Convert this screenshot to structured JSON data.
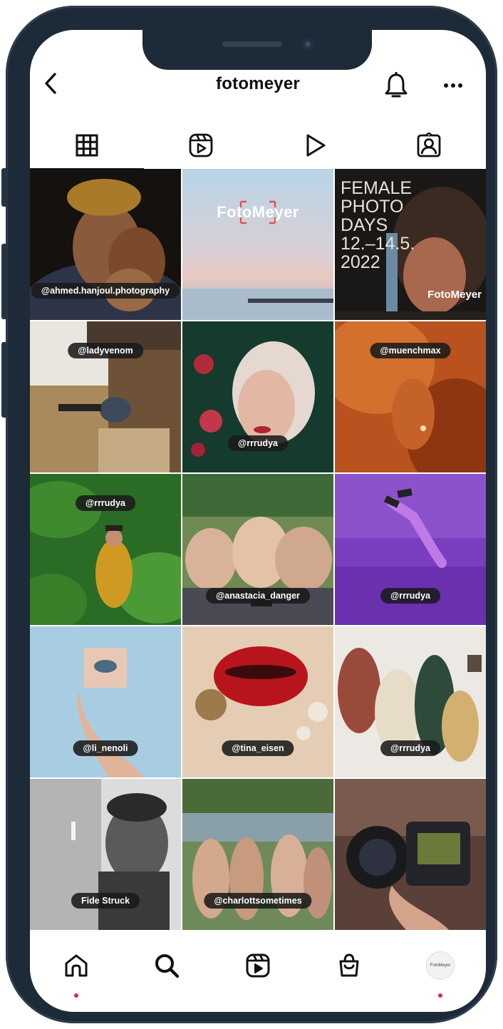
{
  "header": {
    "title": "fotomeyer"
  },
  "tabs": [
    {
      "name": "grid",
      "active": true
    },
    {
      "name": "reels",
      "active": false
    },
    {
      "name": "videos",
      "active": false
    },
    {
      "name": "tagged",
      "active": false
    }
  ],
  "grid": [
    {
      "tag": "@ahmed.hanjoul.photography"
    },
    {
      "tag": "",
      "logo": "FotoMeyer"
    },
    {
      "tag": "",
      "poster_lines": [
        "FEMALE",
        "PHOTO",
        "DAYS",
        "12.–14.5.",
        "2022"
      ],
      "logo": "FotoMeyer"
    },
    {
      "tag": "@ladyvenom"
    },
    {
      "tag": "@rrrudya"
    },
    {
      "tag": "@muenchmax"
    },
    {
      "tag": "@rrrudya"
    },
    {
      "tag": "@anastacia_danger"
    },
    {
      "tag": "@rrrudya"
    },
    {
      "tag": "@li_nenoli"
    },
    {
      "tag": "@tina_eisen"
    },
    {
      "tag": "@rrrudya"
    },
    {
      "tag": "Fide Struck"
    },
    {
      "tag": "@charlottsometimes"
    },
    {
      "tag": ""
    }
  ],
  "bottom_nav": {
    "items": [
      {
        "name": "home",
        "dot": true
      },
      {
        "name": "search",
        "dot": false
      },
      {
        "name": "reels",
        "dot": false
      },
      {
        "name": "shop",
        "dot": false
      },
      {
        "name": "profile",
        "dot": true,
        "avatar_text": "FotoMeyer"
      }
    ]
  },
  "colors": {
    "frame": "#1d2a37",
    "accent_dot": "#e0245e",
    "text": "#111111"
  }
}
